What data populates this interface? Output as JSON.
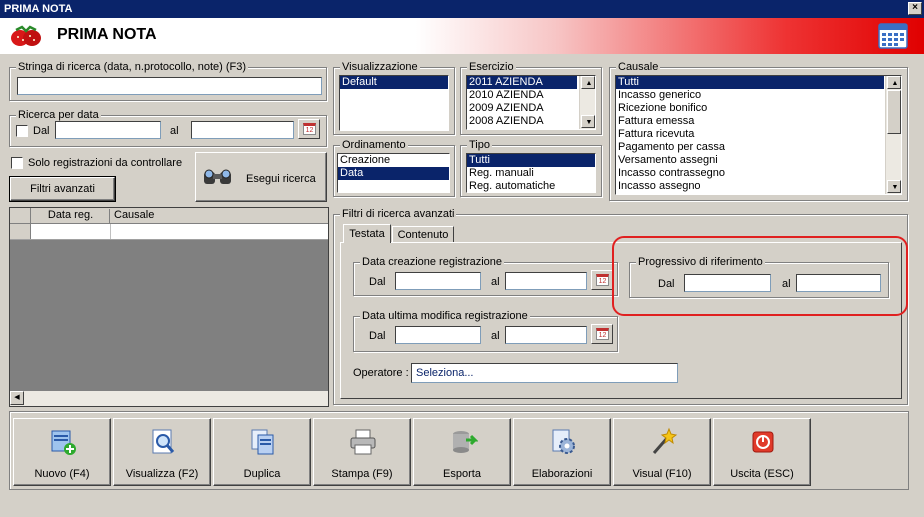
{
  "window": {
    "title": "PRIMA NOTA",
    "close_glyph": "×"
  },
  "banner": {
    "title": "PRIMA NOTA",
    "logo_icon": "strawberries-icon",
    "calendar_icon": "calendar-icon"
  },
  "search": {
    "string_label": "Stringa di ricerca (data, n.protocollo, note) (F3)",
    "string_value": "",
    "date_group_label": "Ricerca per data",
    "dal_label": "Dal",
    "al_label": "al",
    "dal_value": "",
    "al_value": "",
    "only_check_label": "Solo registrazioni da controllare",
    "advanced_button": "Filtri avanzati",
    "run_button": "Esegui ricerca"
  },
  "grid": {
    "columns": [
      "Data reg.",
      "Causale"
    ],
    "rows": [
      [
        "",
        ""
      ]
    ]
  },
  "visualizzazione": {
    "label": "Visualizzazione",
    "items": [
      "Default"
    ],
    "selected": 0
  },
  "ordinamento": {
    "label": "Ordinamento",
    "items": [
      "Creazione",
      "Data"
    ],
    "selected": 1
  },
  "esercizio": {
    "label": "Esercizio",
    "items": [
      "2011 AZIENDA",
      "2010 AZIENDA",
      "2009 AZIENDA",
      "2008 AZIENDA"
    ],
    "selected": 0
  },
  "tipo": {
    "label": "Tipo",
    "items": [
      "Tutti",
      "Reg. manuali",
      "Reg. automatiche"
    ],
    "selected": 0
  },
  "causale": {
    "label": "Causale",
    "items": [
      "Tutti",
      "Incasso generico",
      "Ricezione bonifico",
      "Fattura emessa",
      "Fattura ricevuta",
      "Pagamento per cassa",
      "Versamento assegni",
      "Incasso contrassegno",
      "Incasso assegno"
    ],
    "selected": 0
  },
  "advanced": {
    "label": "Filtri di ricerca avanzati",
    "tabs": [
      "Testata",
      "Contenuto"
    ],
    "active_tab": 0,
    "creation_group": "Data creazione registrazione",
    "modify_group": "Data ultima modifica registrazione",
    "progressive_group": "Progressivo di riferimento",
    "dal_label": "Dal",
    "al_label": "al",
    "operator_label": "Operatore :",
    "operator_value": "Seleziona..."
  },
  "toolbar": {
    "buttons": [
      {
        "label": "Nuovo (F4)",
        "icon": "new-document-icon"
      },
      {
        "label": "Visualizza (F2)",
        "icon": "view-document-icon"
      },
      {
        "label": "Duplica",
        "icon": "duplicate-icon"
      },
      {
        "label": "Stampa (F9)",
        "icon": "printer-icon"
      },
      {
        "label": "Esporta",
        "icon": "export-database-icon"
      },
      {
        "label": "Elaborazioni",
        "icon": "process-gear-icon"
      },
      {
        "label": "Visual (F10)",
        "icon": "magic-wand-icon"
      },
      {
        "label": "Uscita (ESC)",
        "icon": "power-exit-icon"
      }
    ]
  },
  "colors": {
    "selection": "#0a246a",
    "highlight_border": "#e02020",
    "face": "#d4d0c8"
  }
}
